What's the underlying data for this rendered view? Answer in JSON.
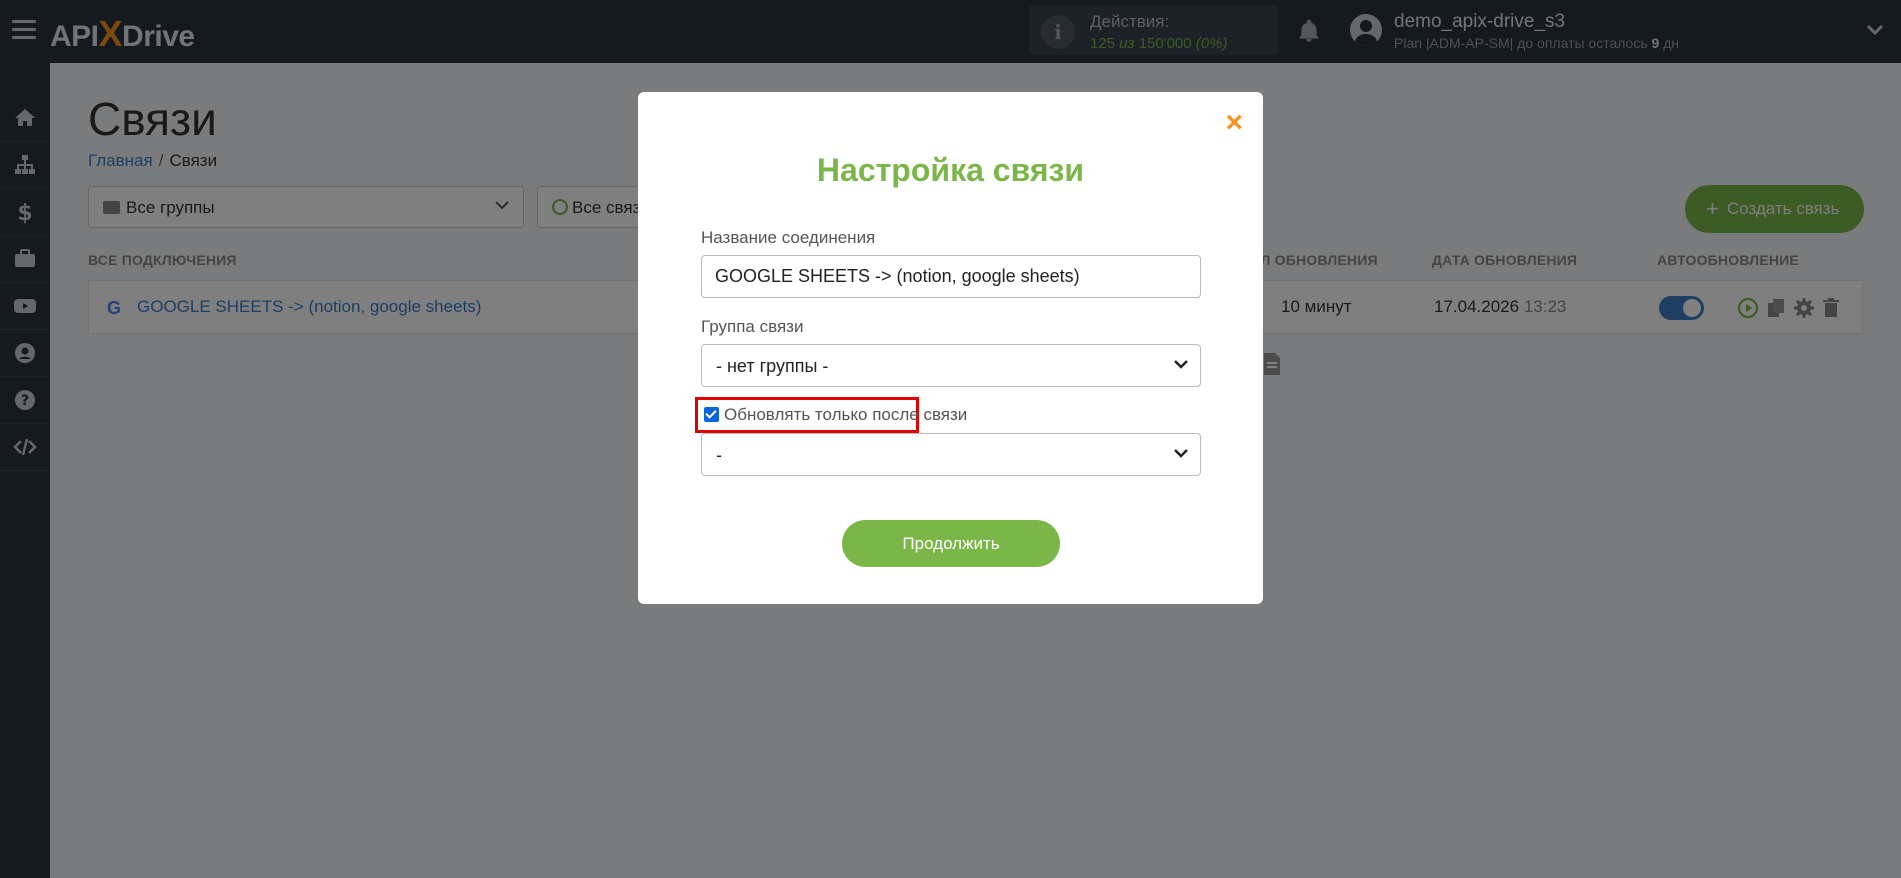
{
  "topbar": {
    "logo_pre": "API",
    "logo_x": "X",
    "logo_post": "Drive",
    "actions_title": "Действия:",
    "actions_used": "125",
    "actions_of": "из",
    "actions_total": "150'000",
    "actions_percent": "(0%)",
    "user_name": "demo_apix-drive_s3",
    "plan_text": "Plan |ADM-AP-SM| до оплаты осталось",
    "plan_days": "9",
    "plan_days_unit": "дн"
  },
  "sidebar": {
    "items": [
      "home-icon",
      "sitemap-icon",
      "dollar-icon",
      "briefcase-icon",
      "youtube-icon",
      "user-icon",
      "help-icon",
      "code-icon"
    ]
  },
  "page": {
    "title": "Связи",
    "breadcrumb_home": "Главная",
    "breadcrumb_sep": "/",
    "breadcrumb_current": "Связи",
    "groups_select": "Все группы",
    "status_select": "Все связи",
    "create_button": "Создать связь",
    "headers": {
      "all": "ВСЕ ПОДКЛЮЧЕНИЯ",
      "interval": "ИНТЕРВАЛ ОБНОВЛЕНИЯ",
      "date": "ДАТА ОБНОВЛЕНИЯ",
      "auto": "АВТООБНОВЛЕНИЕ"
    },
    "rows": [
      {
        "name": "GOOGLE SHEETS -> (notion, google sheets)",
        "interval": "10 минут",
        "date": "17.04.2026",
        "time": "13:23",
        "auto_update": true
      }
    ]
  },
  "modal": {
    "title": "Настройка связи",
    "name_label": "Название соединения",
    "name_value": "GOOGLE SHEETS -> (notion, google sheets)",
    "group_label": "Группа связи",
    "group_value": "- нет группы -",
    "checkbox_label": "Обновлять только после связи",
    "checkbox_checked": true,
    "after_select_value": "-",
    "continue_button": "Продолжить",
    "close": "×"
  },
  "colors": {
    "accent_green": "#7ab648",
    "accent_orange": "#f7941d",
    "link_blue": "#3b7dc4",
    "topbar": "#2b3440",
    "highlight_red": "#e00000"
  }
}
